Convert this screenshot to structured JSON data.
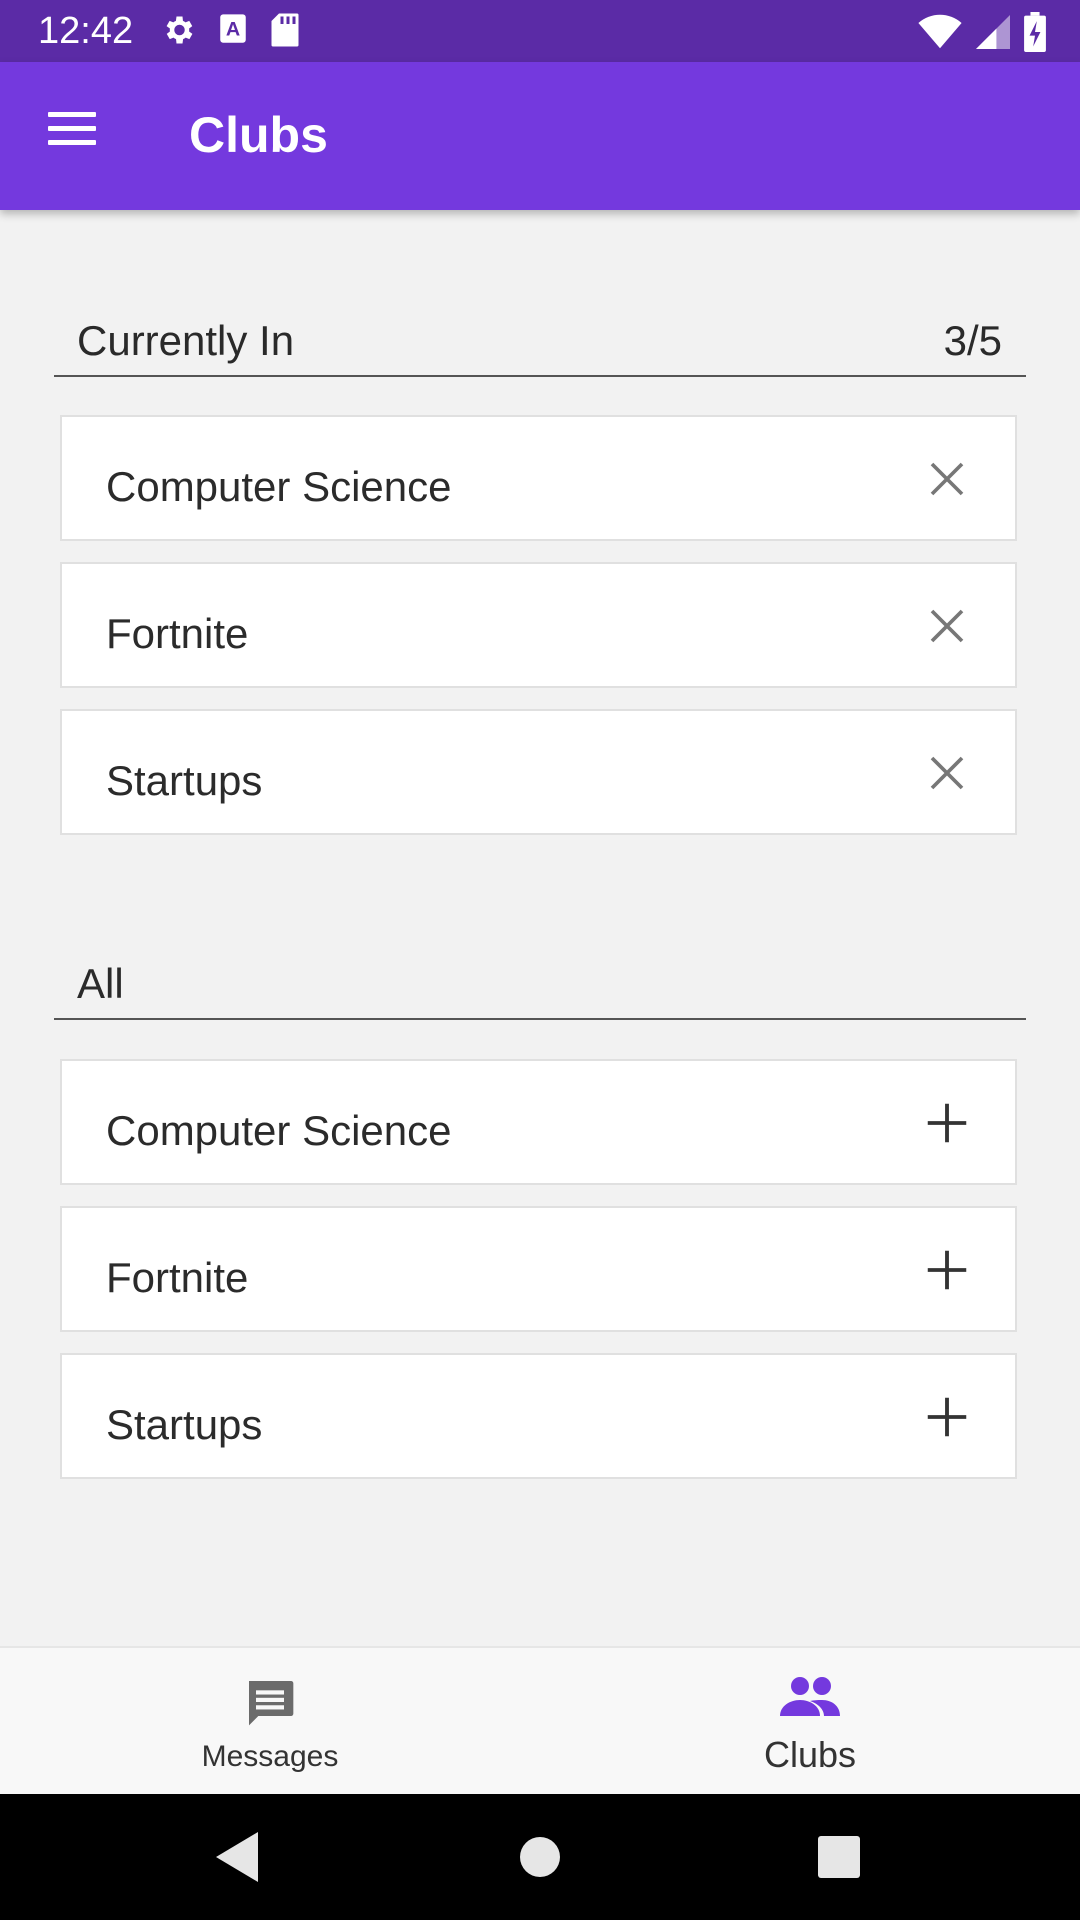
{
  "status_bar": {
    "time": "12:42",
    "icons_left": [
      "gear-icon",
      "a-letter-icon",
      "sd-card-icon"
    ],
    "icons_right": [
      "wifi-icon",
      "signal-icon",
      "battery-charging-icon"
    ]
  },
  "app_bar": {
    "menu_icon": "hamburger-menu-icon",
    "title": "Clubs"
  },
  "currently_in": {
    "title": "Currently In",
    "count": "3/5",
    "items": [
      {
        "label": "Computer Science",
        "action_icon": "close-icon"
      },
      {
        "label": "Fortnite",
        "action_icon": "close-icon"
      },
      {
        "label": "Startups",
        "action_icon": "close-icon"
      }
    ]
  },
  "all": {
    "title": "All",
    "items": [
      {
        "label": "Computer Science",
        "action_icon": "add-icon"
      },
      {
        "label": "Fortnite",
        "action_icon": "add-icon"
      },
      {
        "label": "Startups",
        "action_icon": "add-icon"
      }
    ]
  },
  "bottom_nav": {
    "items": [
      {
        "label": "Messages",
        "icon": "message-icon",
        "selected": false
      },
      {
        "label": "Clubs",
        "icon": "group-icon",
        "selected": true
      }
    ]
  },
  "system_nav": [
    "back-icon",
    "home-icon",
    "recents-icon"
  ],
  "colors": {
    "status_bar": "#5b2ba6",
    "app_bar": "#7439de",
    "accent": "#7439de",
    "background": "#f2f2f2"
  }
}
